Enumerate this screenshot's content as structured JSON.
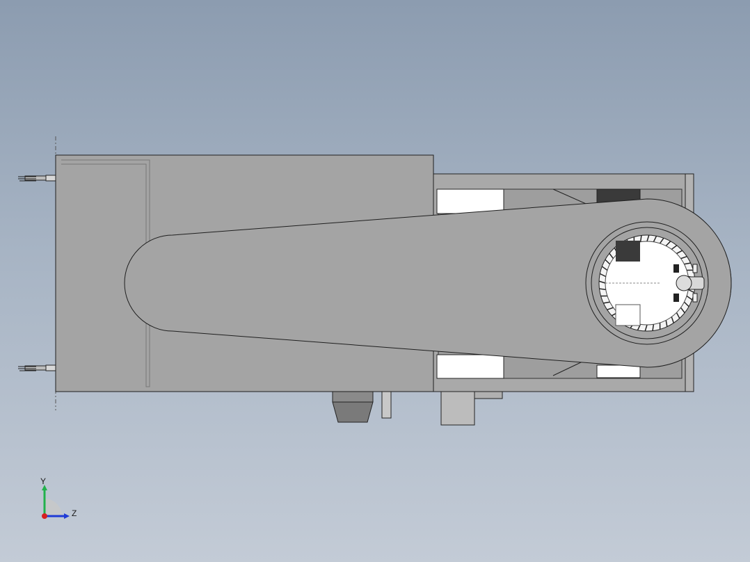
{
  "view": {
    "background_top": "#8c9cb0",
    "background_bottom": "#c3cbd6",
    "part_color": "#a4a4a4",
    "edge_color": "#1e1e1e",
    "white_face": "#ffffff",
    "dark_face": "#3a3a3a"
  },
  "triad": {
    "y_label": "Y",
    "z_label": "Z",
    "y_color": "#22b14c",
    "z_color": "#1f3bd6",
    "x_color": "#d62020"
  }
}
